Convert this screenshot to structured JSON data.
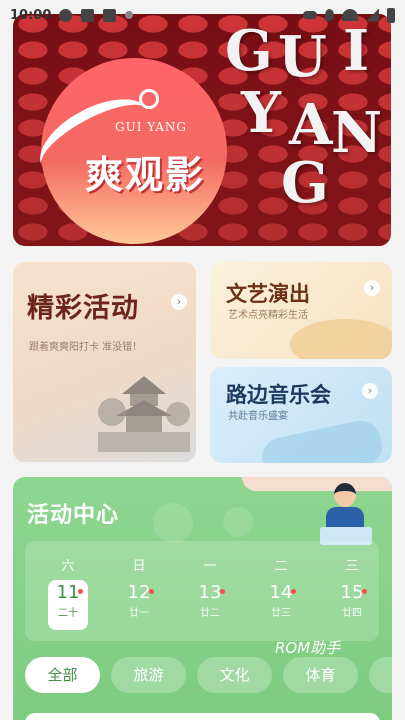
{
  "status_bar": {
    "time": "10:00"
  },
  "banner": {
    "logo_small": "GUI YANG",
    "logo_text": "爽观影",
    "big_letters": [
      "G",
      "U",
      "I",
      "Y",
      "A",
      "N",
      "G"
    ]
  },
  "cards": {
    "events": {
      "title": "精彩活动",
      "subtitle": "跟着爽爽阳打卡  准没错！"
    },
    "arts": {
      "title": "文艺演出",
      "subtitle": "艺术点亮精彩生活"
    },
    "music": {
      "title": "路边音乐会",
      "subtitle": "共赴音乐盛宴"
    }
  },
  "activity_center": {
    "title": "活动中心",
    "calendar": [
      {
        "weekday": "六",
        "day": "11",
        "lunar": "二十",
        "selected": true,
        "dot": true
      },
      {
        "weekday": "日",
        "day": "12",
        "lunar": "廿一",
        "selected": false,
        "dot": true
      },
      {
        "weekday": "一",
        "day": "13",
        "lunar": "廿二",
        "selected": false,
        "dot": true
      },
      {
        "weekday": "二",
        "day": "14",
        "lunar": "廿三",
        "selected": false,
        "dot": true
      },
      {
        "weekday": "三",
        "day": "15",
        "lunar": "廿四",
        "selected": false,
        "dot": true
      }
    ],
    "watermark": "ROM助手",
    "filters": [
      "全部",
      "旅游",
      "文化",
      "体育"
    ],
    "active_filter": "全部"
  },
  "colors": {
    "banner_red": "#a01a1f",
    "accent_green": "#7ccb7f",
    "title_brown": "#6d241a"
  }
}
